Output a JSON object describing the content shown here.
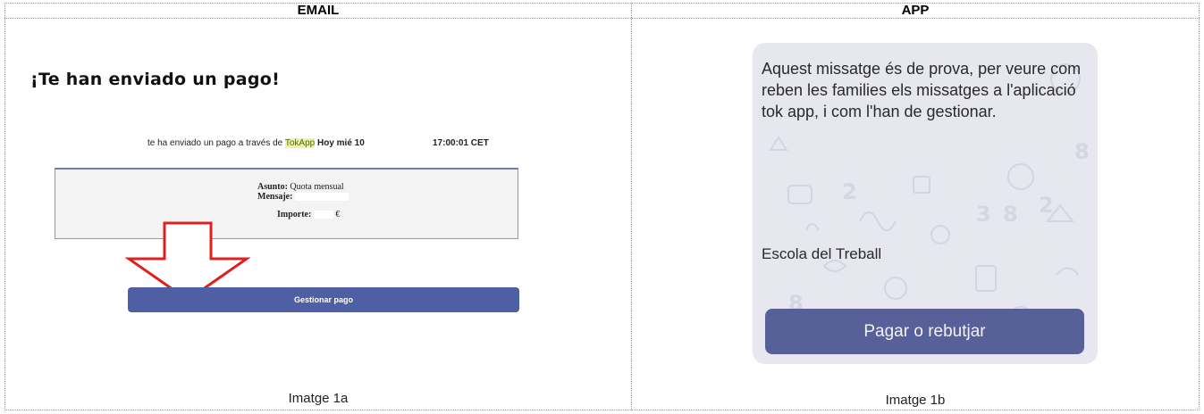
{
  "table": {
    "headers": [
      "EMAIL",
      "APP"
    ],
    "captions": [
      "Imatge 1a",
      "Imatge 1b"
    ]
  },
  "email": {
    "title": "¡Te han enviado un pago!",
    "line_prefix": "te ha enviado un pago a través de",
    "line_brand": "TokApp",
    "line_date": "Hoy mié 10",
    "line_time": "17:00:01 CET",
    "subject_label": "Asunto:",
    "subject_value": "Quota mensual",
    "message_label": "Mensaje:",
    "amount_label": "Importe:",
    "amount_currency": "€",
    "button_label": "Gestionar pago",
    "arrow_color": "#e02020",
    "button_color": "#4e5fa3"
  },
  "app": {
    "message": "Aquest missatge és de prova, per veure com reben les families els missatges a l'aplicació tok app, i com l'han de gestionar.",
    "sender": "Escola del Treball",
    "button_label": "Pagar o rebutjar",
    "button_color": "#58609a",
    "background_icon": "doodle-pattern"
  }
}
